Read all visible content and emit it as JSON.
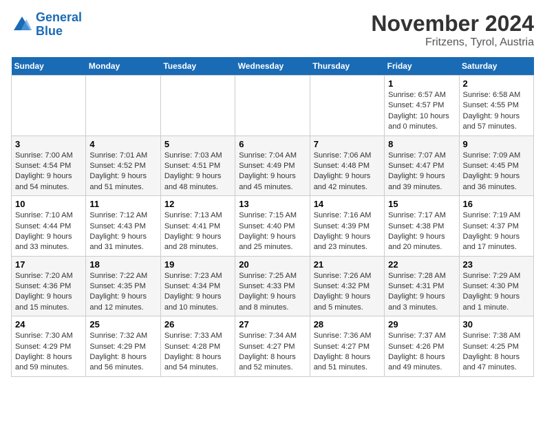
{
  "header": {
    "logo_line1": "General",
    "logo_line2": "Blue",
    "month_title": "November 2024",
    "location": "Fritzens, Tyrol, Austria"
  },
  "days_of_week": [
    "Sunday",
    "Monday",
    "Tuesday",
    "Wednesday",
    "Thursday",
    "Friday",
    "Saturday"
  ],
  "weeks": [
    [
      {
        "day": "",
        "info": ""
      },
      {
        "day": "",
        "info": ""
      },
      {
        "day": "",
        "info": ""
      },
      {
        "day": "",
        "info": ""
      },
      {
        "day": "",
        "info": ""
      },
      {
        "day": "1",
        "info": "Sunrise: 6:57 AM\nSunset: 4:57 PM\nDaylight: 10 hours and 0 minutes."
      },
      {
        "day": "2",
        "info": "Sunrise: 6:58 AM\nSunset: 4:55 PM\nDaylight: 9 hours and 57 minutes."
      }
    ],
    [
      {
        "day": "3",
        "info": "Sunrise: 7:00 AM\nSunset: 4:54 PM\nDaylight: 9 hours and 54 minutes."
      },
      {
        "day": "4",
        "info": "Sunrise: 7:01 AM\nSunset: 4:52 PM\nDaylight: 9 hours and 51 minutes."
      },
      {
        "day": "5",
        "info": "Sunrise: 7:03 AM\nSunset: 4:51 PM\nDaylight: 9 hours and 48 minutes."
      },
      {
        "day": "6",
        "info": "Sunrise: 7:04 AM\nSunset: 4:49 PM\nDaylight: 9 hours and 45 minutes."
      },
      {
        "day": "7",
        "info": "Sunrise: 7:06 AM\nSunset: 4:48 PM\nDaylight: 9 hours and 42 minutes."
      },
      {
        "day": "8",
        "info": "Sunrise: 7:07 AM\nSunset: 4:47 PM\nDaylight: 9 hours and 39 minutes."
      },
      {
        "day": "9",
        "info": "Sunrise: 7:09 AM\nSunset: 4:45 PM\nDaylight: 9 hours and 36 minutes."
      }
    ],
    [
      {
        "day": "10",
        "info": "Sunrise: 7:10 AM\nSunset: 4:44 PM\nDaylight: 9 hours and 33 minutes."
      },
      {
        "day": "11",
        "info": "Sunrise: 7:12 AM\nSunset: 4:43 PM\nDaylight: 9 hours and 31 minutes."
      },
      {
        "day": "12",
        "info": "Sunrise: 7:13 AM\nSunset: 4:41 PM\nDaylight: 9 hours and 28 minutes."
      },
      {
        "day": "13",
        "info": "Sunrise: 7:15 AM\nSunset: 4:40 PM\nDaylight: 9 hours and 25 minutes."
      },
      {
        "day": "14",
        "info": "Sunrise: 7:16 AM\nSunset: 4:39 PM\nDaylight: 9 hours and 23 minutes."
      },
      {
        "day": "15",
        "info": "Sunrise: 7:17 AM\nSunset: 4:38 PM\nDaylight: 9 hours and 20 minutes."
      },
      {
        "day": "16",
        "info": "Sunrise: 7:19 AM\nSunset: 4:37 PM\nDaylight: 9 hours and 17 minutes."
      }
    ],
    [
      {
        "day": "17",
        "info": "Sunrise: 7:20 AM\nSunset: 4:36 PM\nDaylight: 9 hours and 15 minutes."
      },
      {
        "day": "18",
        "info": "Sunrise: 7:22 AM\nSunset: 4:35 PM\nDaylight: 9 hours and 12 minutes."
      },
      {
        "day": "19",
        "info": "Sunrise: 7:23 AM\nSunset: 4:34 PM\nDaylight: 9 hours and 10 minutes."
      },
      {
        "day": "20",
        "info": "Sunrise: 7:25 AM\nSunset: 4:33 PM\nDaylight: 9 hours and 8 minutes."
      },
      {
        "day": "21",
        "info": "Sunrise: 7:26 AM\nSunset: 4:32 PM\nDaylight: 9 hours and 5 minutes."
      },
      {
        "day": "22",
        "info": "Sunrise: 7:28 AM\nSunset: 4:31 PM\nDaylight: 9 hours and 3 minutes."
      },
      {
        "day": "23",
        "info": "Sunrise: 7:29 AM\nSunset: 4:30 PM\nDaylight: 9 hours and 1 minute."
      }
    ],
    [
      {
        "day": "24",
        "info": "Sunrise: 7:30 AM\nSunset: 4:29 PM\nDaylight: 8 hours and 59 minutes."
      },
      {
        "day": "25",
        "info": "Sunrise: 7:32 AM\nSunset: 4:29 PM\nDaylight: 8 hours and 56 minutes."
      },
      {
        "day": "26",
        "info": "Sunrise: 7:33 AM\nSunset: 4:28 PM\nDaylight: 8 hours and 54 minutes."
      },
      {
        "day": "27",
        "info": "Sunrise: 7:34 AM\nSunset: 4:27 PM\nDaylight: 8 hours and 52 minutes."
      },
      {
        "day": "28",
        "info": "Sunrise: 7:36 AM\nSunset: 4:27 PM\nDaylight: 8 hours and 51 minutes."
      },
      {
        "day": "29",
        "info": "Sunrise: 7:37 AM\nSunset: 4:26 PM\nDaylight: 8 hours and 49 minutes."
      },
      {
        "day": "30",
        "info": "Sunrise: 7:38 AM\nSunset: 4:25 PM\nDaylight: 8 hours and 47 minutes."
      }
    ]
  ]
}
